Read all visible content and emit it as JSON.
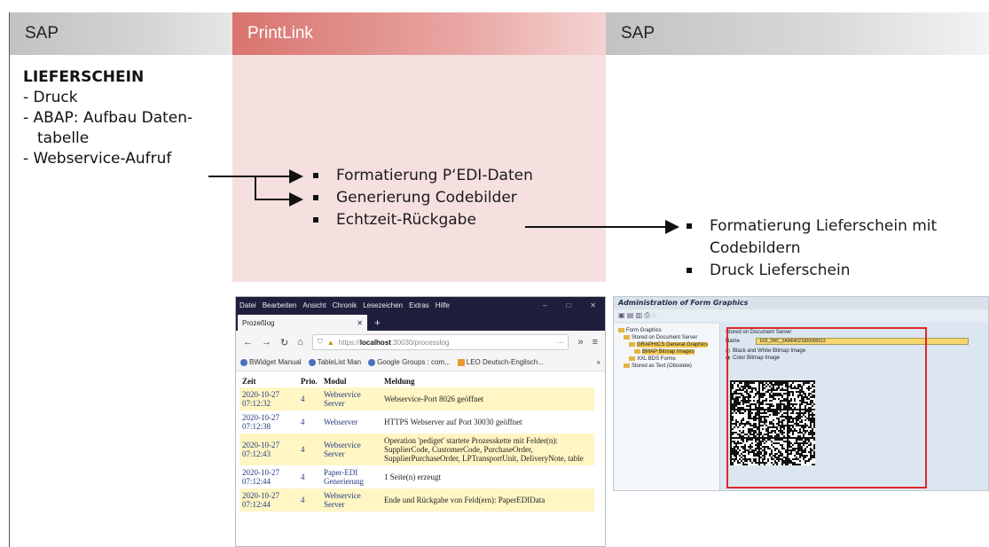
{
  "headers": {
    "sap_left": "SAP",
    "printlink": "PrintLink",
    "sap_right": "SAP"
  },
  "left": {
    "title": "LIEFERSCHEIN",
    "items": [
      "- Druck",
      "- ABAP: Aufbau Daten-",
      "  tabelle",
      "- Webservice-Aufruf"
    ]
  },
  "middle": {
    "items": [
      "Formatierung P‘EDI-Daten",
      "Generierung Codebilder",
      "Echtzeit-Rückgabe"
    ]
  },
  "right": {
    "item1_line1": "Formatierung Lieferschein mit",
    "item1_line2": "Codebildern",
    "item2": "Druck Lieferschein"
  },
  "browser": {
    "menu": [
      "Datei",
      "Bearbeiten",
      "Ansicht",
      "Chronik",
      "Lesezeichen",
      "Extras",
      "Hilfe"
    ],
    "tab_title": "Prozeßlog",
    "url_prefix": "https://",
    "url_host": "localhost",
    "url_rest": ":30030/processlog",
    "url_more": "···",
    "bookmarks": [
      "BWidget Manual",
      "TableList Man",
      "Google Groups : com...",
      "LEO Deutsch-Englisch..."
    ],
    "columns": [
      "Zeit",
      "Prio.",
      "Modul",
      "Meldung"
    ],
    "rows": [
      {
        "date": "2020-10-27",
        "time": "07:12:32",
        "prio": "4",
        "modul": "Webservice Server",
        "msg": "Webservice-Port 8026 geöffnet",
        "hl": true
      },
      {
        "date": "2020-10-27",
        "time": "07:12:38",
        "prio": "4",
        "modul": "Webserver",
        "msg": "HTTPS Webserver auf Port 30030 geöffnet",
        "hl": false
      },
      {
        "date": "2020-10-27",
        "time": "07:12:43",
        "prio": "4",
        "modul": "Webservice Server",
        "msg": "Operation 'pediget' startete Prozesskette mit Felder(n): SupplierCode, CustomerCode, PurchaseOrder, SupplierPurchaseOrder, LPTransportUnit, DeliveryNote, table",
        "hl": true
      },
      {
        "date": "2020-10-27",
        "time": "07:12:44",
        "prio": "4",
        "modul": "Paper-EDI Generierung",
        "msg": "1 Seite(n) erzeugt",
        "hl": false
      },
      {
        "date": "2020-10-27",
        "time": "07:12:44",
        "prio": "4",
        "modul": "Webservice Server",
        "msg": "Ende und Rückgabe von Feld(ern): PaperEDIData",
        "hl": true
      }
    ]
  },
  "sap_screen": {
    "title": "Administration of Form Graphics",
    "tree": [
      "Form Graphics",
      "Stored on Document Server",
      "GRAPHICS General Graphics",
      "BMAP Bitmap Images",
      "XXL BDS Forms",
      "Stored as Text (Obsolete)"
    ],
    "group_title": "Stored on Document Server",
    "name_label": "Name",
    "name_value": "EDI_2MC_2AM04021000000013",
    "radio1": "Black and White Bitmap Image",
    "radio2": "Color Bitmap Image"
  }
}
